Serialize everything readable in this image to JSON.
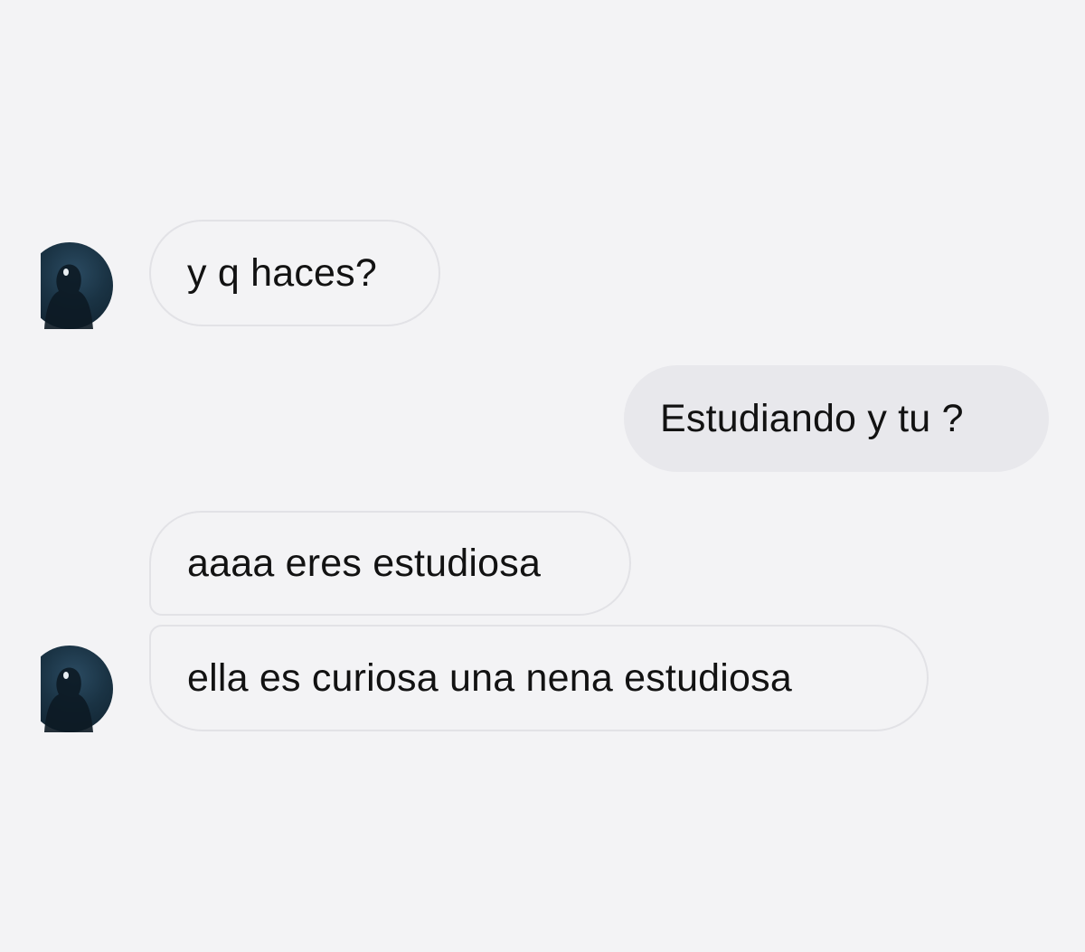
{
  "messages": [
    {
      "direction": "incoming",
      "text": "y q haces?",
      "show_avatar": true
    },
    {
      "direction": "outgoing",
      "text": "Estudiando y tu ?",
      "show_avatar": false
    },
    {
      "direction": "incoming",
      "text": "aaaa eres estudiosa",
      "show_avatar": false
    },
    {
      "direction": "incoming",
      "text": "ella es curiosa una nena estudiosa",
      "show_avatar": true
    }
  ],
  "colors": {
    "background": "#f3f3f5",
    "incoming_border": "#e2e2e6",
    "outgoing_fill": "#e8e8ec",
    "text": "#121212",
    "avatar_base": "#1a3344"
  },
  "icons": {
    "avatar": "hooded-figure-avatar"
  }
}
